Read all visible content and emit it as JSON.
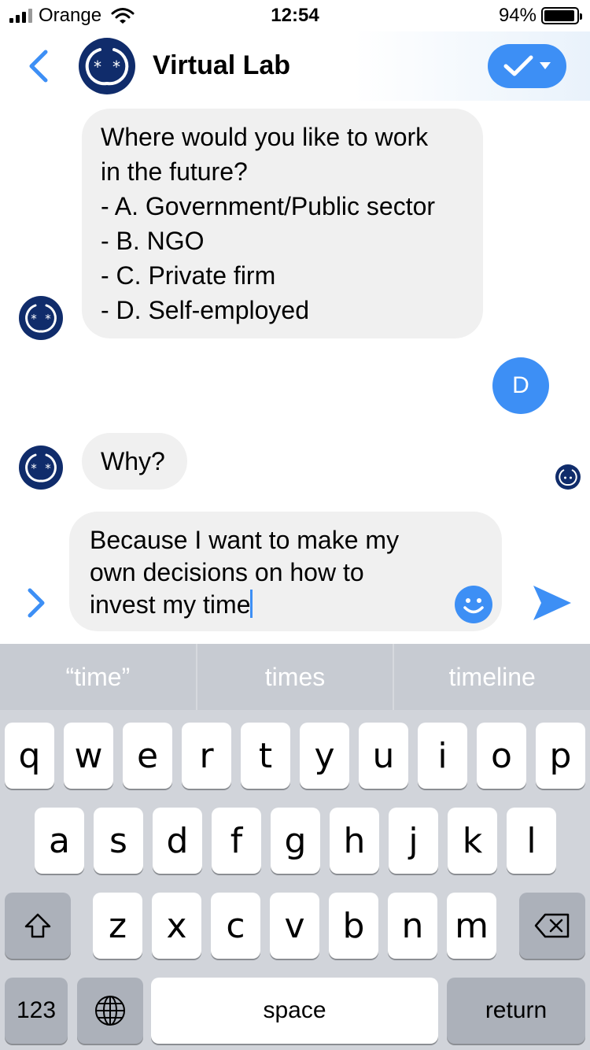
{
  "status_bar": {
    "carrier": "Orange",
    "time": "12:54",
    "battery": "94%",
    "battery_level": 0.94
  },
  "header": {
    "title": "Virtual Lab",
    "back_icon": "chevron-left-icon",
    "action_icon": "checkmark-dropdown-icon"
  },
  "messages": {
    "question_lines": [
      "Where would you like to work",
      "in the future?",
      "- A. Government/Public sector",
      "- B. NGO",
      "- C. Private firm",
      "- D. Self-employed"
    ],
    "user_initial": "D",
    "why": "Why?"
  },
  "composer": {
    "lines": [
      "Because I want to make my",
      "own decisions on how to",
      "invest my time"
    ]
  },
  "keyboard": {
    "suggestions": [
      "“time”",
      "times",
      "timeline"
    ],
    "row1": [
      "q",
      "w",
      "e",
      "r",
      "t",
      "y",
      "u",
      "i",
      "o",
      "p"
    ],
    "row2": [
      "a",
      "s",
      "d",
      "f",
      "g",
      "h",
      "j",
      "k",
      "l"
    ],
    "row3": [
      "z",
      "x",
      "c",
      "v",
      "b",
      "n",
      "m"
    ],
    "numbers_label": "123",
    "space_label": "space",
    "return_label": "return"
  },
  "colors": {
    "accent": "#3d8ff5",
    "brand_navy": "#102c6b",
    "bubble": "#f0f0f0"
  }
}
